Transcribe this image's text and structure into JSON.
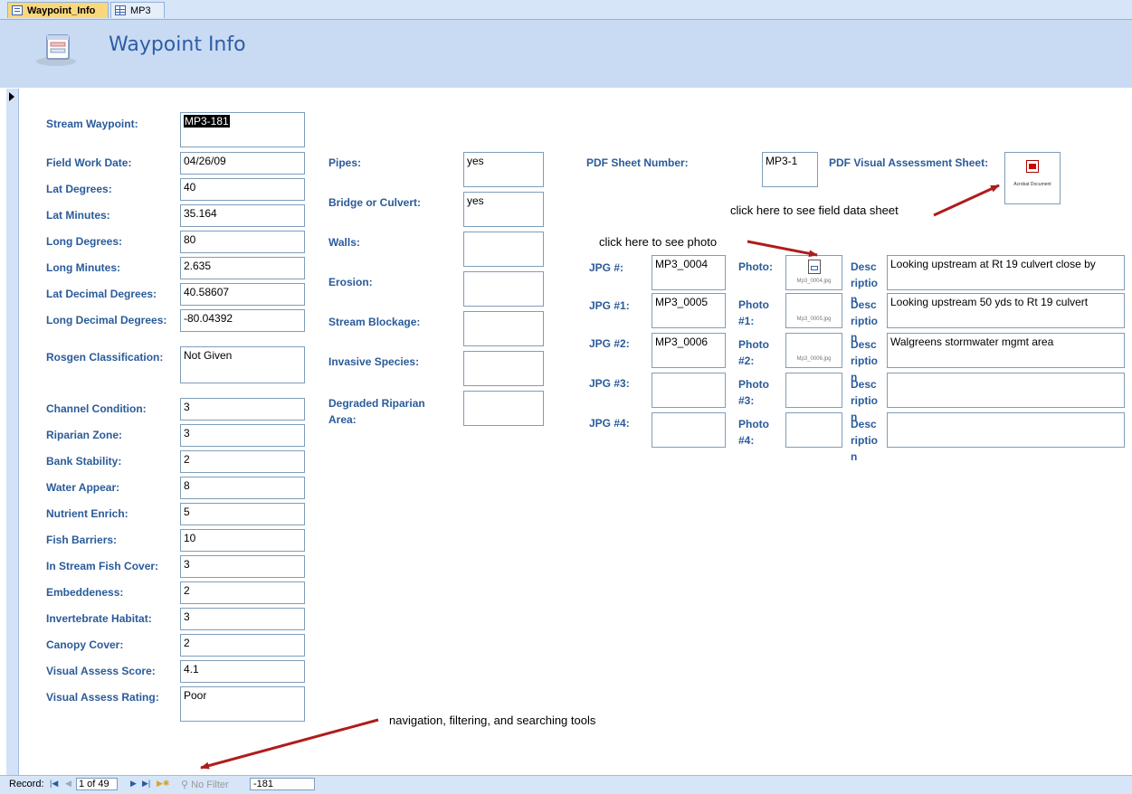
{
  "tabs": [
    {
      "label": "Waypoint_Info",
      "active": true
    },
    {
      "label": "MP3",
      "active": false
    }
  ],
  "header": {
    "title": "Waypoint Info"
  },
  "left_fields": [
    {
      "label": "Stream Waypoint:",
      "value": "MP3-181"
    },
    {
      "label": "Field Work Date:",
      "value": "04/26/09"
    },
    {
      "label": "Lat Degrees:",
      "value": "40"
    },
    {
      "label": "Lat Minutes:",
      "value": "35.164"
    },
    {
      "label": "Long Degrees:",
      "value": "80"
    },
    {
      "label": "Long Minutes:",
      "value": "2.635"
    },
    {
      "label": "Lat Decimal Degrees:",
      "value": "40.58607"
    },
    {
      "label": "Long Decimal Degrees:",
      "value": "-80.04392"
    },
    {
      "label": "Rosgen Classification:",
      "value": "Not Given"
    },
    {
      "label": "Channel Condition:",
      "value": "3"
    },
    {
      "label": "Riparian Zone:",
      "value": "3"
    },
    {
      "label": "Bank Stability:",
      "value": "2"
    },
    {
      "label": "Water Appear:",
      "value": "8"
    },
    {
      "label": "Nutrient Enrich:",
      "value": "5"
    },
    {
      "label": "Fish Barriers:",
      "value": "10"
    },
    {
      "label": "In Stream Fish Cover:",
      "value": "3"
    },
    {
      "label": "Embeddeness:",
      "value": "2"
    },
    {
      "label": "Invertebrate Habitat:",
      "value": "3"
    },
    {
      "label": "Canopy Cover:",
      "value": "2"
    },
    {
      "label": "Visual Assess Score:",
      "value": "4.1"
    },
    {
      "label": "Visual Assess Rating:",
      "value": "Poor"
    }
  ],
  "middle_fields": [
    {
      "label": "Pipes:",
      "value": "yes"
    },
    {
      "label": "Bridge or Culvert:",
      "value": "yes"
    },
    {
      "label": "Walls:",
      "value": ""
    },
    {
      "label": "Erosion:",
      "value": ""
    },
    {
      "label": "Stream Blockage:",
      "value": ""
    },
    {
      "label": "Invasive Species:",
      "value": ""
    },
    {
      "label": "Degraded Riparian Area:",
      "value": ""
    }
  ],
  "pdf": {
    "sheet_label": "PDF Sheet Number:",
    "sheet_value": "MP3-1",
    "visual_label": "PDF Visual Assessment Sheet:",
    "attachment_caption": "Acrobat Document"
  },
  "photos": [
    {
      "jpg_label": "JPG #:",
      "jpg_value": "MP3_0004",
      "photo_label": "Photo:",
      "thumb_caption": "Mp3_0004.jpg",
      "desc_label": "Description",
      "desc_value": "Looking upstream at Rt 19 culvert close by"
    },
    {
      "jpg_label": "JPG #1:",
      "jpg_value": "MP3_0005",
      "photo_label": "Photo #1:",
      "thumb_caption": "Mp3_0005.jpg",
      "desc_label": "Description",
      "desc_value": "Looking upstream 50 yds to Rt 19 culvert"
    },
    {
      "jpg_label": "JPG #2:",
      "jpg_value": "MP3_0006",
      "photo_label": "Photo #2:",
      "thumb_caption": "Mp3_0006.jpg",
      "desc_label": "Description",
      "desc_value": "Walgreens stormwater mgmt area"
    },
    {
      "jpg_label": "JPG #3:",
      "jpg_value": "",
      "photo_label": "Photo #3:",
      "thumb_caption": "",
      "desc_label": "Description",
      "desc_value": ""
    },
    {
      "jpg_label": "JPG #4:",
      "jpg_value": "",
      "photo_label": "Photo #4:",
      "thumb_caption": "",
      "desc_label": "Description",
      "desc_value": ""
    }
  ],
  "annotations": {
    "field_sheet": "click here to see field data sheet",
    "photo": "click here to see photo",
    "nav": "navigation, filtering, and searching tools"
  },
  "status": {
    "record_label": "Record:",
    "record_value": "1 of 49",
    "filter_label": "No Filter",
    "search_value": "-181"
  },
  "colors": {
    "label": "#2a5b9a",
    "header_bg": "#c9dbf3",
    "arrow": "#b01c1c"
  }
}
